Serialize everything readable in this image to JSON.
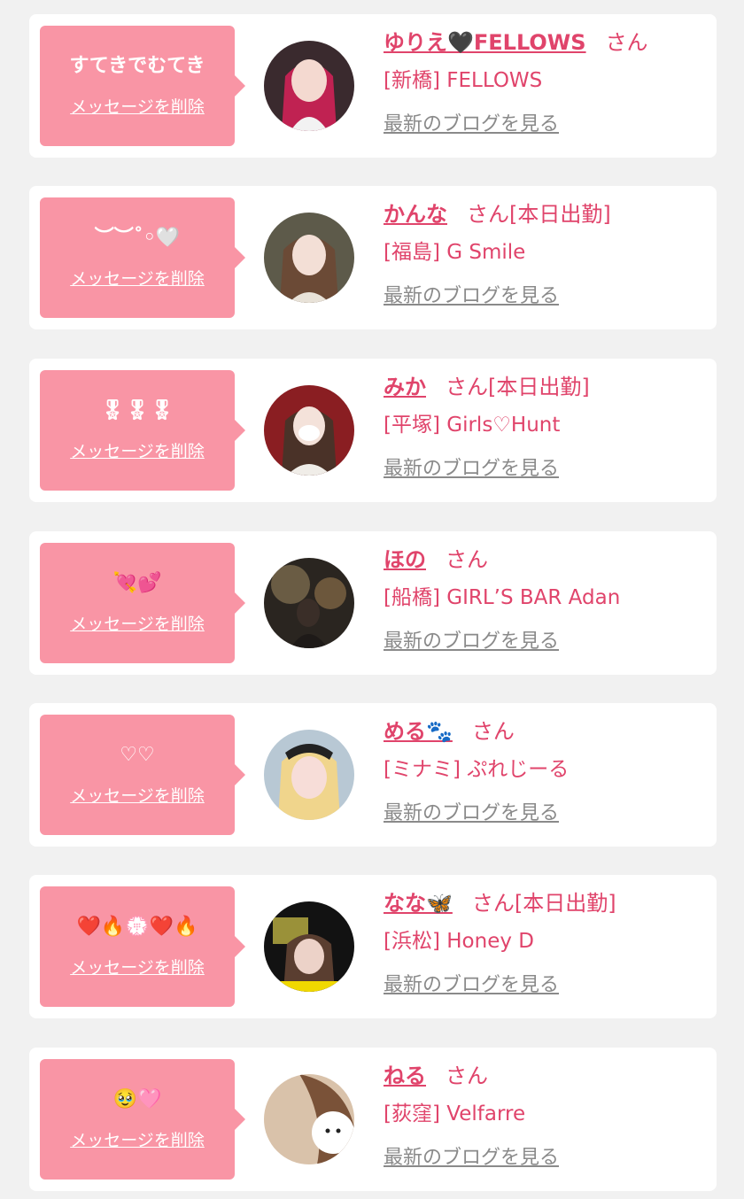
{
  "colors": {
    "page_bg": "#f1f1f1",
    "card_bg": "#ffffff",
    "bubble_bg": "#f995a5",
    "accent": "#e0446b",
    "blog_link": "#8a8a8a"
  },
  "items": [
    {
      "message": "すてきでむてき",
      "delete_label": "メッセージを削除",
      "name": "ゆりえ🖤FELLOWS",
      "suffix": "さん",
      "area_shop": "[新橋] FELLOWS",
      "blog_label": "最新のブログを見る",
      "avatar_icon": "avatar-photo-red-hair"
    },
    {
      "message": "︶︶˚◦🤍",
      "delete_label": "メッセージを削除",
      "name": "かんな",
      "suffix": "さん[本日出勤]",
      "area_shop": "[福島] G Smile",
      "blog_label": "最新のブログを見る",
      "avatar_icon": "avatar-photo-long-hair"
    },
    {
      "message": "🎖🎖🎖",
      "delete_label": "メッセージを削除",
      "name": "みか",
      "suffix": "さん[本日出勤]",
      "area_shop": "[平塚] Girls♡Hunt",
      "blog_label": "最新のブログを見る",
      "avatar_icon": "avatar-photo-mask"
    },
    {
      "message": "💘💕",
      "delete_label": "メッセージを削除",
      "name": "ほの",
      "suffix": "さん",
      "area_shop": "[船橋] GIRL’S BAR Adan",
      "blog_label": "最新のブログを見る",
      "avatar_icon": "avatar-photo-night"
    },
    {
      "message": "♡♡",
      "delete_label": "メッセージを削除",
      "name": "める🐾",
      "suffix": "さん",
      "area_shop": "[ミナミ] ぷれじーる",
      "blog_label": "最新のブログを見る",
      "avatar_icon": "avatar-photo-blonde"
    },
    {
      "message": "❤️🔥💮❤️🔥",
      "delete_label": "メッセージを削除",
      "name": "なな🦋",
      "suffix": "さん[本日出勤]",
      "area_shop": "[浜松] Honey D",
      "blog_label": "最新のブログを見る",
      "avatar_icon": "avatar-photo-card"
    },
    {
      "message": "🥹🩷",
      "delete_label": "メッセージを削除",
      "name": "ねる",
      "suffix": "さん",
      "area_shop": "[荻窪] Velfarre",
      "blog_label": "最新のブログを見る",
      "avatar_icon": "avatar-photo-face-sticker"
    }
  ]
}
